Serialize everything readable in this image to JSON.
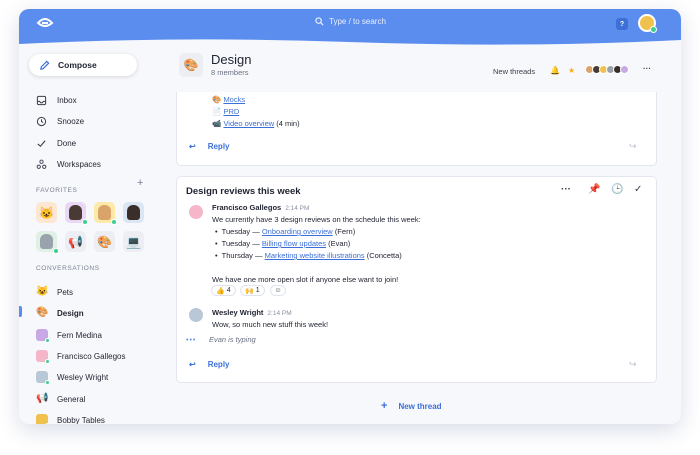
{
  "topbar": {
    "search_placeholder": "Type / to search",
    "help_label": "?"
  },
  "sidebar": {
    "compose_label": "Compose",
    "nav": [
      {
        "label": "Inbox",
        "icon": "inbox-icon"
      },
      {
        "label": "Snooze",
        "icon": "clock-icon"
      },
      {
        "label": "Done",
        "icon": "check-icon"
      },
      {
        "label": "Workspaces",
        "icon": "workspaces-icon"
      }
    ],
    "favorites_heading": "FAVORITES",
    "favorites_add": "+",
    "conversations_heading": "CONVERSATIONS",
    "conversations": [
      {
        "label": "Pets",
        "icon": "cat-icon"
      },
      {
        "label": "Design",
        "icon": "palette-icon"
      },
      {
        "label": "Fern Medina",
        "icon": "avatar"
      },
      {
        "label": "Francisco Gallegos",
        "icon": "avatar"
      },
      {
        "label": "Wesley Wright",
        "icon": "avatar"
      },
      {
        "label": "General",
        "icon": "megaphone-icon"
      },
      {
        "label": "Bobby Tables",
        "icon": "avatar"
      }
    ]
  },
  "channel": {
    "title": "Design",
    "members": "8 members",
    "new_threads": "New threads"
  },
  "thread1": {
    "mocks": "Mocks",
    "prd": "PRD",
    "video": "Video overview",
    "video_suffix": "(4 min)",
    "reply": "Reply"
  },
  "thread2": {
    "title": "Design reviews this week",
    "msg1": {
      "author": "Francisco Gallegos",
      "time": "2:14 PM",
      "intro": "We currently have 3 design reviews on the schedule this week:",
      "items": [
        {
          "day": "Tuesday —",
          "link": "Onboarding overview",
          "who": "(Fern)"
        },
        {
          "day": "Tuesday —",
          "link": "Billing flow updates",
          "who": "(Evan)"
        },
        {
          "day": "Thursday —",
          "link": "Marketing website illustrations",
          "who": "(Concetta)"
        }
      ],
      "outro": "We have one more open slot if anyone else want to join!",
      "reactions": [
        {
          "emoji": "👍",
          "count": "4"
        },
        {
          "emoji": "🙌",
          "count": "1"
        }
      ]
    },
    "msg2": {
      "author": "Wesley Wright",
      "time": "2:14 PM",
      "text": "Wow, so much new stuff this week!"
    },
    "typing": "Evan is typing",
    "reply": "Reply"
  },
  "new_thread": "New thread"
}
